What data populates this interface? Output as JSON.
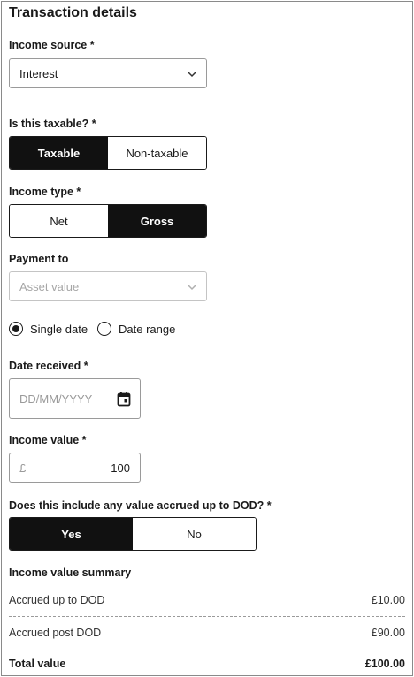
{
  "title": "Transaction details",
  "income_source": {
    "label": "Income source *",
    "value": "Interest",
    "icon": "chevron-down-icon"
  },
  "taxable": {
    "label": "Is this taxable? *",
    "options": [
      "Taxable",
      "Non-taxable"
    ],
    "selected": "Taxable"
  },
  "income_type": {
    "label": "Income type *",
    "options": [
      "Net",
      "Gross"
    ],
    "selected": "Gross"
  },
  "payment_to": {
    "label": "Payment to",
    "placeholder": "Asset value",
    "icon": "chevron-down-icon"
  },
  "date_mode": {
    "options": [
      "Single date",
      "Date range"
    ],
    "selected": "Single date"
  },
  "date_received": {
    "label": "Date received *",
    "placeholder": "DD/MM/YYYY",
    "icon": "calendar-icon"
  },
  "income_value": {
    "label": "Income value *",
    "currency": "£",
    "value": "100"
  },
  "accrued": {
    "label": "Does this include any value accrued up to DOD? *",
    "options": [
      "Yes",
      "No"
    ],
    "selected": "Yes"
  },
  "summary": {
    "label": "Income value summary",
    "rows": [
      {
        "label": "Accrued up to DOD",
        "value": "£10.00"
      },
      {
        "label": "Accrued post DOD",
        "value": "£90.00"
      }
    ],
    "total_label": "Total value",
    "total_value": "£100.00"
  },
  "colors": {
    "active_bg": "#111111",
    "border": "#9a9a9a",
    "placeholder": "#9a9a9a"
  }
}
